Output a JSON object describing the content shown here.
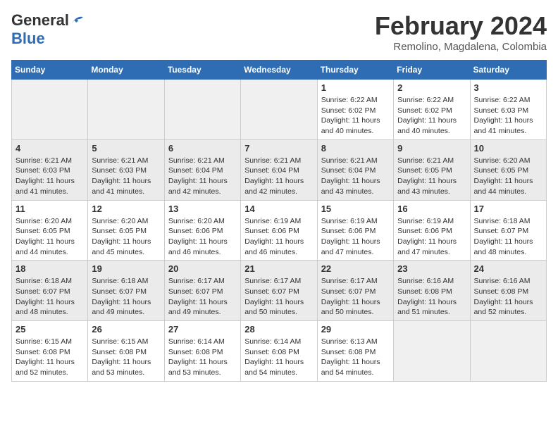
{
  "header": {
    "logo": {
      "general": "General",
      "blue": "Blue"
    },
    "title": "February 2024",
    "location": "Remolino, Magdalena, Colombia"
  },
  "calendar": {
    "days_of_week": [
      "Sunday",
      "Monday",
      "Tuesday",
      "Wednesday",
      "Thursday",
      "Friday",
      "Saturday"
    ],
    "weeks": [
      [
        {
          "day": "",
          "info": ""
        },
        {
          "day": "",
          "info": ""
        },
        {
          "day": "",
          "info": ""
        },
        {
          "day": "",
          "info": ""
        },
        {
          "day": "1",
          "info": "Sunrise: 6:22 AM\nSunset: 6:02 PM\nDaylight: 11 hours\nand 40 minutes."
        },
        {
          "day": "2",
          "info": "Sunrise: 6:22 AM\nSunset: 6:02 PM\nDaylight: 11 hours\nand 40 minutes."
        },
        {
          "day": "3",
          "info": "Sunrise: 6:22 AM\nSunset: 6:03 PM\nDaylight: 11 hours\nand 41 minutes."
        }
      ],
      [
        {
          "day": "4",
          "info": "Sunrise: 6:21 AM\nSunset: 6:03 PM\nDaylight: 11 hours\nand 41 minutes."
        },
        {
          "day": "5",
          "info": "Sunrise: 6:21 AM\nSunset: 6:03 PM\nDaylight: 11 hours\nand 41 minutes."
        },
        {
          "day": "6",
          "info": "Sunrise: 6:21 AM\nSunset: 6:04 PM\nDaylight: 11 hours\nand 42 minutes."
        },
        {
          "day": "7",
          "info": "Sunrise: 6:21 AM\nSunset: 6:04 PM\nDaylight: 11 hours\nand 42 minutes."
        },
        {
          "day": "8",
          "info": "Sunrise: 6:21 AM\nSunset: 6:04 PM\nDaylight: 11 hours\nand 43 minutes."
        },
        {
          "day": "9",
          "info": "Sunrise: 6:21 AM\nSunset: 6:05 PM\nDaylight: 11 hours\nand 43 minutes."
        },
        {
          "day": "10",
          "info": "Sunrise: 6:20 AM\nSunset: 6:05 PM\nDaylight: 11 hours\nand 44 minutes."
        }
      ],
      [
        {
          "day": "11",
          "info": "Sunrise: 6:20 AM\nSunset: 6:05 PM\nDaylight: 11 hours\nand 44 minutes."
        },
        {
          "day": "12",
          "info": "Sunrise: 6:20 AM\nSunset: 6:05 PM\nDaylight: 11 hours\nand 45 minutes."
        },
        {
          "day": "13",
          "info": "Sunrise: 6:20 AM\nSunset: 6:06 PM\nDaylight: 11 hours\nand 46 minutes."
        },
        {
          "day": "14",
          "info": "Sunrise: 6:19 AM\nSunset: 6:06 PM\nDaylight: 11 hours\nand 46 minutes."
        },
        {
          "day": "15",
          "info": "Sunrise: 6:19 AM\nSunset: 6:06 PM\nDaylight: 11 hours\nand 47 minutes."
        },
        {
          "day": "16",
          "info": "Sunrise: 6:19 AM\nSunset: 6:06 PM\nDaylight: 11 hours\nand 47 minutes."
        },
        {
          "day": "17",
          "info": "Sunrise: 6:18 AM\nSunset: 6:07 PM\nDaylight: 11 hours\nand 48 minutes."
        }
      ],
      [
        {
          "day": "18",
          "info": "Sunrise: 6:18 AM\nSunset: 6:07 PM\nDaylight: 11 hours\nand 48 minutes."
        },
        {
          "day": "19",
          "info": "Sunrise: 6:18 AM\nSunset: 6:07 PM\nDaylight: 11 hours\nand 49 minutes."
        },
        {
          "day": "20",
          "info": "Sunrise: 6:17 AM\nSunset: 6:07 PM\nDaylight: 11 hours\nand 49 minutes."
        },
        {
          "day": "21",
          "info": "Sunrise: 6:17 AM\nSunset: 6:07 PM\nDaylight: 11 hours\nand 50 minutes."
        },
        {
          "day": "22",
          "info": "Sunrise: 6:17 AM\nSunset: 6:07 PM\nDaylight: 11 hours\nand 50 minutes."
        },
        {
          "day": "23",
          "info": "Sunrise: 6:16 AM\nSunset: 6:08 PM\nDaylight: 11 hours\nand 51 minutes."
        },
        {
          "day": "24",
          "info": "Sunrise: 6:16 AM\nSunset: 6:08 PM\nDaylight: 11 hours\nand 52 minutes."
        }
      ],
      [
        {
          "day": "25",
          "info": "Sunrise: 6:15 AM\nSunset: 6:08 PM\nDaylight: 11 hours\nand 52 minutes."
        },
        {
          "day": "26",
          "info": "Sunrise: 6:15 AM\nSunset: 6:08 PM\nDaylight: 11 hours\nand 53 minutes."
        },
        {
          "day": "27",
          "info": "Sunrise: 6:14 AM\nSunset: 6:08 PM\nDaylight: 11 hours\nand 53 minutes."
        },
        {
          "day": "28",
          "info": "Sunrise: 6:14 AM\nSunset: 6:08 PM\nDaylight: 11 hours\nand 54 minutes."
        },
        {
          "day": "29",
          "info": "Sunrise: 6:13 AM\nSunset: 6:08 PM\nDaylight: 11 hours\nand 54 minutes."
        },
        {
          "day": "",
          "info": ""
        },
        {
          "day": "",
          "info": ""
        }
      ]
    ]
  }
}
